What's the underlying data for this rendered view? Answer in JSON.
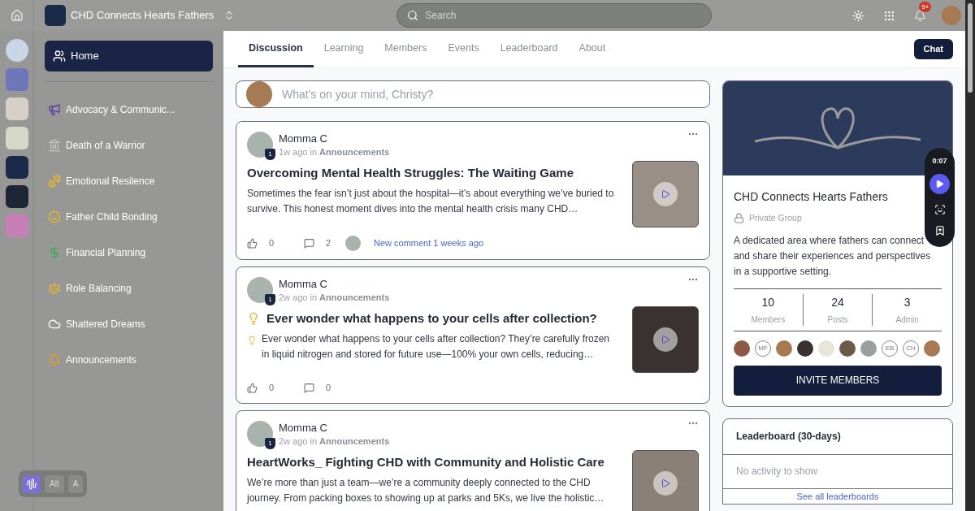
{
  "header": {
    "group_name": "CHD Connects Hearts Fathers"
  },
  "search": {
    "placeholder": "Search"
  },
  "notifications": {
    "badge": "9+"
  },
  "sidebar": {
    "items": [
      {
        "label": "Home",
        "selected": true
      },
      {
        "label": "Advocacy & Communic...",
        "selected": false
      },
      {
        "label": "Death of a Warrior",
        "selected": false
      },
      {
        "label": "Emotional Resilence",
        "selected": false
      },
      {
        "label": "Father Child Bonding",
        "selected": false
      },
      {
        "label": "Financial Planning",
        "selected": false
      },
      {
        "label": "Role Balancing",
        "selected": false
      },
      {
        "label": "Shattered Dreams",
        "selected": false
      },
      {
        "label": "Announcements",
        "selected": false
      }
    ]
  },
  "tabs": [
    {
      "label": "Discussion",
      "selected": true
    },
    {
      "label": "Learning",
      "selected": false
    },
    {
      "label": "Members",
      "selected": false
    },
    {
      "label": "Events",
      "selected": false
    },
    {
      "label": "Leaderboard",
      "selected": false
    },
    {
      "label": "About",
      "selected": false
    }
  ],
  "chat_button": "Chat",
  "composer": {
    "placeholder": "What's on your mind, Christy?"
  },
  "posts": [
    {
      "author": "Momma C",
      "level_badge": "1",
      "time": "1w ago in",
      "category": "Announcements",
      "kind": "plain",
      "title": "Overcoming Mental Health Struggles: The Waiting Game",
      "excerpt": "Sometimes the fear isn’t just about the hospital—it’s about everything we’ve buried to survive. This honest moment dives into the mental health crisis many CHD…",
      "likes": "0",
      "comments": "2",
      "activity": "New comment 1 weeks ago"
    },
    {
      "author": "Momma C",
      "level_badge": "1",
      "time": "2w ago in",
      "category": "Announcements",
      "kind": "tip",
      "title": "Ever wonder what happens to your cells after collection?",
      "excerpt": "Ever wonder what happens to your cells after collection? They’re carefully frozen in liquid nitrogen and stored for future use—100% your own cells, reducing…",
      "likes": "0",
      "comments": "0"
    },
    {
      "author": "Momma C",
      "level_badge": "1",
      "time": "2w ago in",
      "category": "Announcements",
      "kind": "plain",
      "title": "HeartWorks_ Fighting CHD with Community and Holistic Care",
      "excerpt": "We’re more than just a team—we’re a community deeply connected to the CHD journey. From packing boxes to showing up at parks and 5Ks, we live the holistic…"
    }
  ],
  "group_card": {
    "name": "CHD Connects Hearts Fathers",
    "privacy": "Private Group",
    "description": "A dedicated area where fathers can connect and share their experiences and perspectives in a supportive setting.",
    "stats": [
      {
        "value": "10",
        "label": "Members"
      },
      {
        "value": "24",
        "label": "Posts"
      },
      {
        "value": "3",
        "label": "Admin"
      }
    ],
    "members": [
      {
        "kind": "photo"
      },
      {
        "kind": "initials",
        "initials": "MF"
      },
      {
        "kind": "photo"
      },
      {
        "kind": "photo"
      },
      {
        "kind": "photo"
      },
      {
        "kind": "photo"
      },
      {
        "kind": "photo"
      },
      {
        "kind": "initials",
        "initials": "EB"
      },
      {
        "kind": "initials",
        "initials": "CH"
      },
      {
        "kind": "photo"
      }
    ],
    "invite_button": "INVITE MEMBERS"
  },
  "leaderboard": {
    "title": "Leaderboard (30-days)",
    "empty_text": "No activity to show",
    "link": "See all leaderboards"
  },
  "recorder": {
    "time": "0:07"
  },
  "key_widget": {
    "keys": [
      "Alt",
      "A"
    ]
  }
}
